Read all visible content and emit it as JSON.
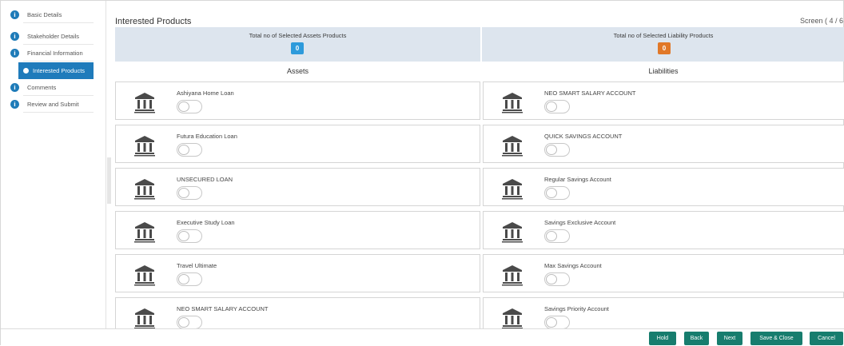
{
  "sidebar": {
    "steps": [
      {
        "label": "Basic Details",
        "icon": "info-icon"
      },
      {
        "label": "Stakeholder Details",
        "icon": "info-icon"
      },
      {
        "label": "Financial Information",
        "icon": "info-icon"
      },
      {
        "label": "Interested Products",
        "icon": "info-icon",
        "active": true
      },
      {
        "label": "Comments",
        "icon": "info-icon"
      },
      {
        "label": "Review and Submit",
        "icon": "info-icon"
      }
    ],
    "icon_glyph": "i"
  },
  "header": {
    "title": "Interested Products",
    "screen_indicator": "Screen ( 4 / 6"
  },
  "summary": {
    "assets_caption": "Total no of Selected Assets Products",
    "assets_count": "0",
    "liabilities_caption": "Total no of Selected Liability Products",
    "liabilities_count": "0"
  },
  "columns": {
    "assets": "Assets",
    "liabilities": "Liabilities"
  },
  "assets": [
    "Ashiyana Home Loan",
    "Futura Education Loan",
    "UNSECURED LOAN",
    "Executive Study Loan",
    "Travel Ultimate",
    "NEO SMART SALARY ACCOUNT"
  ],
  "liabilities": [
    "NEO SMART SALARY ACCOUNT",
    "QUICK SAVINGS ACCOUNT",
    "Regular Savings Account",
    "Savings Exclusive Account",
    "Max Savings Account",
    "Savings Priority Account"
  ],
  "footer": {
    "hold": "Hold",
    "back": "Back",
    "next": "Next",
    "save_close": "Save & Close",
    "cancel": "Cancel"
  },
  "colors": {
    "step_active": "#1f7bbb",
    "assets_badge": "#2d9adb",
    "liabilities_badge": "#e17828",
    "button": "#177d6e",
    "summary_bg": "#dde5ee"
  }
}
